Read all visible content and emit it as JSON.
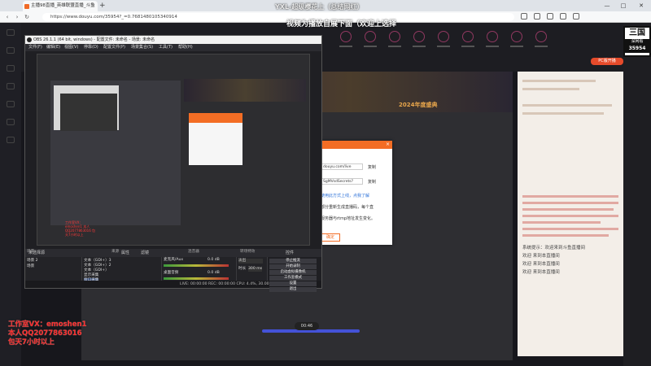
{
  "browser": {
    "tab_title": "主播98直播_英雄联盟直播_斗鱼",
    "tab_close": "×",
    "new_tab": "+",
    "url": "https://www.douyu.com/35954?_=0.7681480105340914",
    "win_min": "—",
    "win_max": "□",
    "win_close": "✕"
  },
  "captions": {
    "top1": "YXL-超级樱花上（总结网红）",
    "top2": "视频为播放自展下面（欢迎上选择",
    "watermark": [
      "工作室VX：emoshen1",
      "本人QQ2077863016",
      "包天7小时以上"
    ]
  },
  "logo_badge": {
    "line1": "三国",
    "line2": "深网看",
    "line3": "35954"
  },
  "pc_badge": "PC版开播",
  "banner_text": "2024年度盛典",
  "dialog": {
    "close": "×",
    "url_value": "douyu.com/live",
    "key_value": "SgMVsdSecrets?",
    "copy1": "复制",
    "copy2": "复制",
    "hint_link": "使用此方式上线，点我了解",
    "hint1": "部分重新生成直播码，每个直",
    "hint2": "服务器与rtmp地址发生变化。",
    "button": "确定"
  },
  "chat": {
    "notes": [
      "系统提示：欢迎来到斗鱼直播间",
      "欢迎 来到本直播间",
      "欢迎 来到本直播间",
      "欢迎 来到本直播间"
    ]
  },
  "player": {
    "time": "00:46"
  },
  "obs": {
    "title": "OBS 26.1.1 (64 bit, windows) - 配置文件: 未命名 - 场景: 未命名",
    "menu": [
      "文件(F)",
      "编辑(E)",
      "视图(V)",
      "停靠(D)",
      "配置文件(P)",
      "场景集合(S)",
      "工具(T)",
      "帮助(H)"
    ],
    "nested_caption": "工作室VX: emoshen1 本人QQ2077863016 包天7小时以上",
    "selected_label": "未选择源",
    "btn_properties": "属性",
    "btn_filters": "滤镜",
    "dock_titles": [
      "场景",
      "来源",
      "混音器",
      "转场特效",
      "控件"
    ],
    "scenes": [
      "场景 2",
      "场景"
    ],
    "sources": [
      "文本（GDI+）3",
      "文本（GDI+）2",
      "文本（GDI+）",
      "显示采集",
      "窗口采集"
    ],
    "mixer": [
      {
        "label": "麦克风/Aux",
        "db": "0.0 dB"
      },
      {
        "label": "桌面音频",
        "db": "0.0 dB"
      }
    ],
    "transition": {
      "type": "淡出",
      "duration_label": "时长",
      "duration_value": "300 ms"
    },
    "controls": [
      "停止推流",
      "开始录制",
      "启动虚拟摄像机",
      "工作室模式",
      "设置",
      "退出"
    ],
    "status": "LIVE: 00:00:00   REC: 00:00:00   CPU: 4.4%, 30.00 fps"
  }
}
